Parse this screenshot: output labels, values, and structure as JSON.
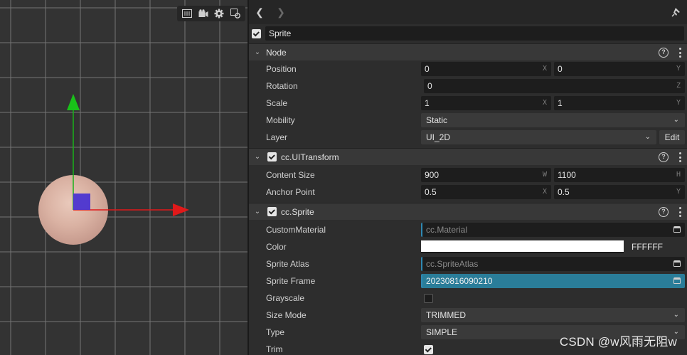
{
  "scene": {
    "toolbar_icons": [
      "grid-toggle-icon",
      "camera-icon",
      "gear-icon",
      "gizmo-icon"
    ],
    "axis_colors": {
      "x": "#e0191a",
      "y": "#19b219"
    }
  },
  "inspector": {
    "nav": {
      "back_icon": "chevron-left-icon",
      "forward_icon": "chevron-right-icon",
      "pin_icon": "pin-icon"
    },
    "node_name": "Sprite",
    "node_section": {
      "title": "Node",
      "position": {
        "label": "Position",
        "x": "0",
        "y": "0",
        "x_axis": "X",
        "y_axis": "Y"
      },
      "rotation": {
        "label": "Rotation",
        "z": "0",
        "z_axis": "Z"
      },
      "scale": {
        "label": "Scale",
        "x": "1",
        "y": "1",
        "x_axis": "X",
        "y_axis": "Y"
      },
      "mobility": {
        "label": "Mobility",
        "value": "Static"
      },
      "layer": {
        "label": "Layer",
        "value": "UI_2D",
        "edit_label": "Edit"
      }
    },
    "uitransform_section": {
      "title": "cc.UITransform",
      "content_size": {
        "label": "Content Size",
        "w": "900",
        "h": "1100",
        "w_axis": "W",
        "h_axis": "H"
      },
      "anchor_point": {
        "label": "Anchor Point",
        "x": "0.5",
        "y": "0.5",
        "x_axis": "X",
        "y_axis": "Y"
      }
    },
    "sprite_section": {
      "title": "cc.Sprite",
      "custom_material": {
        "label": "CustomMaterial",
        "value": "cc.Material"
      },
      "color": {
        "label": "Color",
        "hex": "FFFFFF",
        "swatch": "#ffffff"
      },
      "sprite_atlas": {
        "label": "Sprite Atlas",
        "value": "cc.SpriteAtlas"
      },
      "sprite_frame": {
        "label": "Sprite Frame",
        "value": "20230816090210"
      },
      "grayscale": {
        "label": "Grayscale"
      },
      "size_mode": {
        "label": "Size Mode",
        "value": "TRIMMED"
      },
      "type": {
        "label": "Type",
        "value": "SIMPLE"
      },
      "trim": {
        "label": "Trim"
      }
    }
  },
  "watermark": "CSDN @w风雨无阻w"
}
